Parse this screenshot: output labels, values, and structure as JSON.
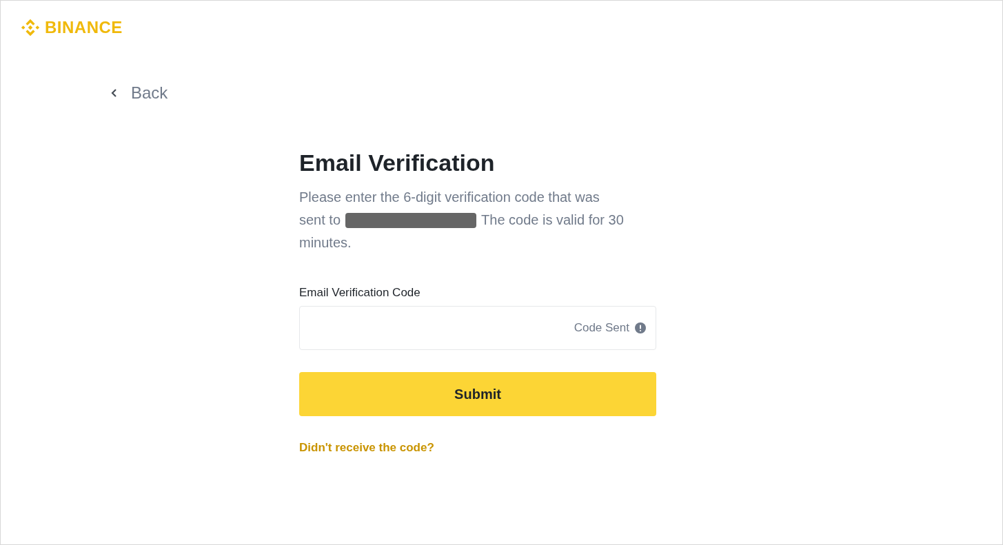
{
  "brand": {
    "name": "BINANCE"
  },
  "back": {
    "label": "Back"
  },
  "heading": "Email Verification",
  "description": {
    "line_1": "Please enter the 6-digit verification code that was",
    "line_2_start": "sent to",
    "redacted": true,
    "line_2_end": "The code is valid for 30",
    "line_3": "minutes."
  },
  "code_field": {
    "label": "Email Verification Code",
    "status": "Code Sent"
  },
  "submit": {
    "label": "Submit"
  },
  "help_link": "Didn't receive the code?"
}
